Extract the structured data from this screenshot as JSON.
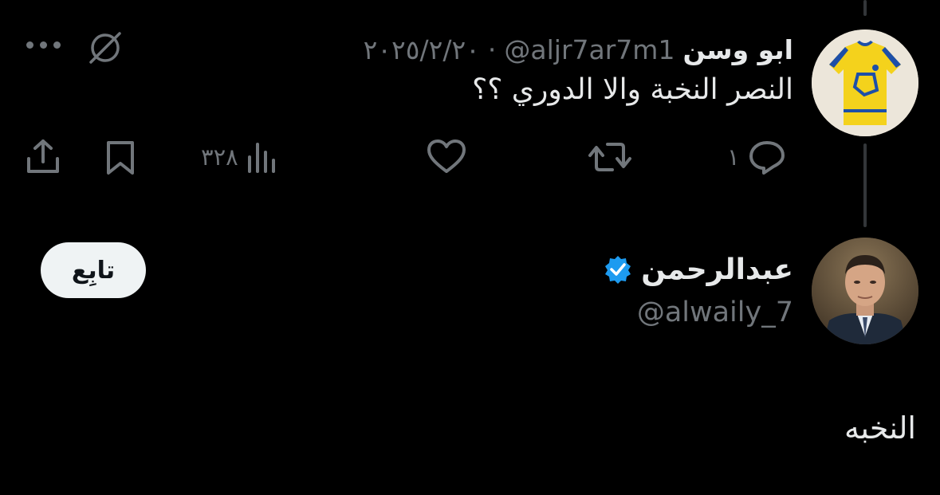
{
  "tweet": {
    "author_name": "ابو وسن",
    "author_handle": "@aljr7ar7m1",
    "separator": "·",
    "date": "٢٠٢٥/٢/٢٠",
    "text": "النصر النخبة والا الدوري ؟؟",
    "avatar_icon": "yellow-jersey-avatar",
    "actions": {
      "reply_count": "١",
      "retweet_count": "",
      "like_count": "",
      "views_count": "٣٢٨"
    }
  },
  "profile_card": {
    "display_name": "عبدالرحمن",
    "verified": true,
    "handle": "@alwaily_7",
    "follow_label": "تابِع",
    "bio": "النخبه",
    "avatar_icon": "man-in-suit-avatar"
  },
  "colors": {
    "background": "#000000",
    "primary_text": "#e7e9ea",
    "secondary_text": "#71767b",
    "verified_blue": "#1d9bf0",
    "follow_button_bg": "#eff3f4"
  }
}
